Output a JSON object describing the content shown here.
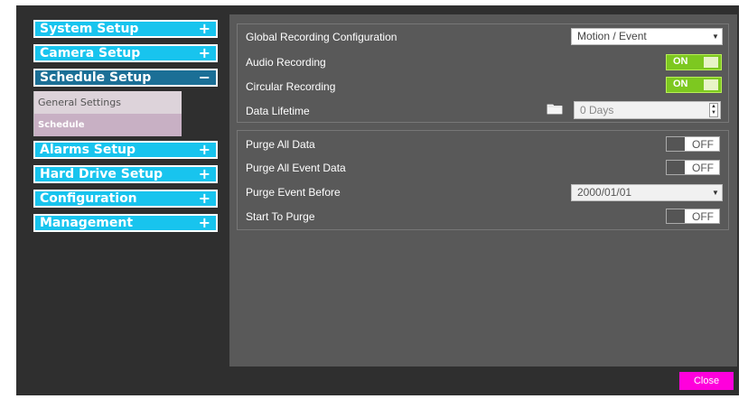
{
  "sidebar": {
    "menu": [
      {
        "label": "System Setup",
        "sign": "+"
      },
      {
        "label": "Camera Setup",
        "sign": "+"
      },
      {
        "label": "Schedule Setup",
        "sign": "−"
      },
      {
        "label": "Alarms Setup",
        "sign": "+"
      },
      {
        "label": "Hard Drive Setup",
        "sign": "+"
      },
      {
        "label": "Configuration",
        "sign": "+"
      },
      {
        "label": "Management",
        "sign": "+"
      }
    ],
    "submenu": [
      {
        "label": "General Settings"
      },
      {
        "label": "Schedule"
      }
    ]
  },
  "recording": {
    "global_label": "Global Recording Configuration",
    "global_value": "Motion / Event",
    "audio_label": "Audio Recording",
    "audio_state": "ON",
    "circular_label": "Circular Recording",
    "circular_state": "ON",
    "lifetime_label": "Data Lifetime",
    "lifetime_placeholder": "0 Days"
  },
  "purge": {
    "all_label": "Purge All Data",
    "all_state": "OFF",
    "event_label": "Purge All Event Data",
    "event_state": "OFF",
    "before_label": "Purge Event Before",
    "before_value": "2000/01/01",
    "start_label": "Start To Purge",
    "start_state": "OFF"
  },
  "footer": {
    "close_label": "Close"
  },
  "colors": {
    "menu": "#18c4ee",
    "menu_active": "#1b6f96",
    "toggle_on": "#7dc820",
    "close_button": "#ff00dc"
  }
}
